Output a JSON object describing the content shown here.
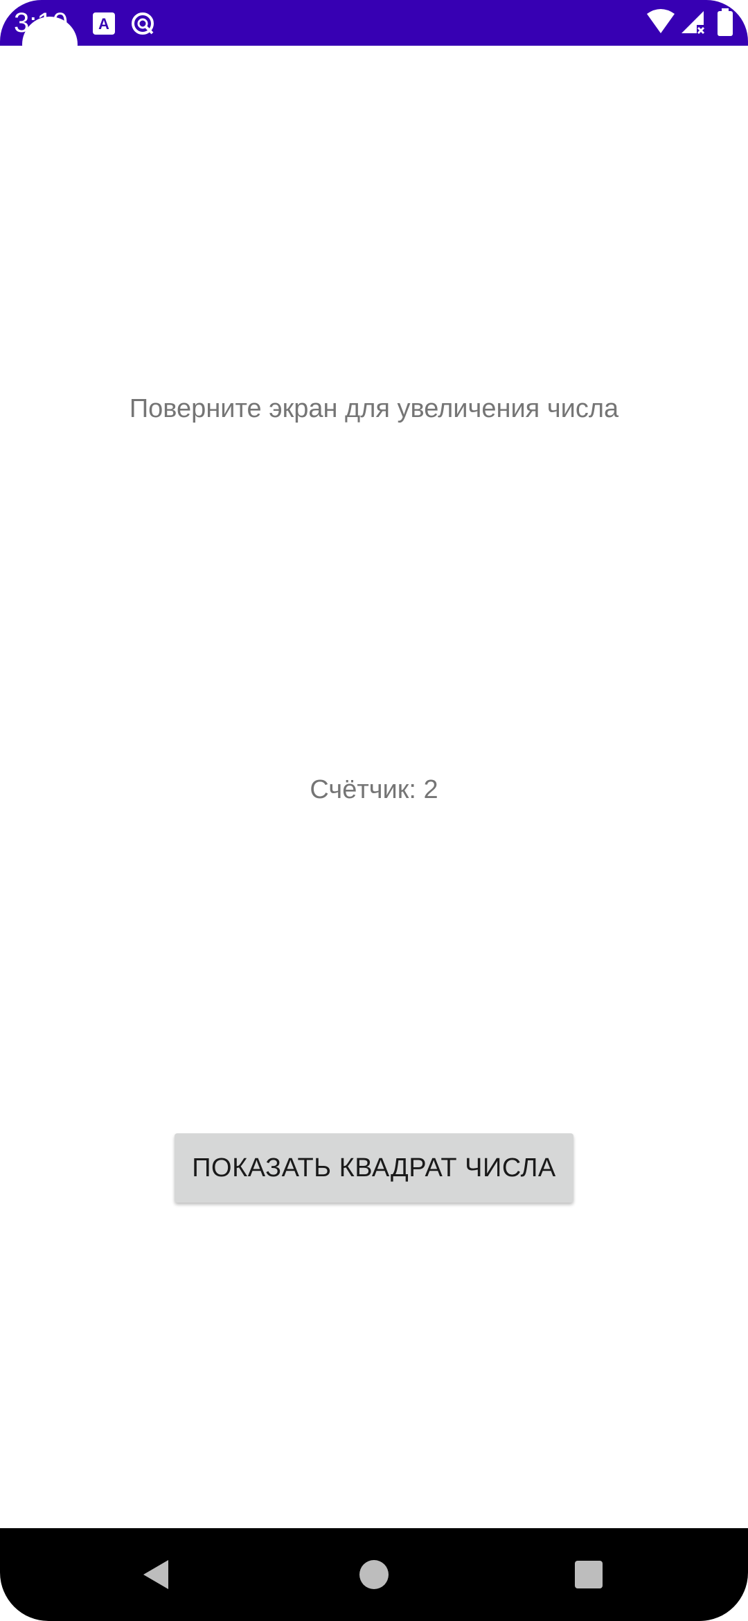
{
  "status_bar": {
    "time": "3:10",
    "background_color": "#3700B3",
    "icons": [
      "accessibility-a-icon",
      "sync-icon",
      "wifi-icon",
      "signal-icon",
      "battery-icon"
    ]
  },
  "main": {
    "instruction": "Поверните экран для увеличения числа",
    "counter": "Счётчик: 2",
    "button_label": "ПОКАЗАТЬ КВАДРАТ ЧИСЛА"
  },
  "nav_bar": {
    "icons": [
      "back-icon",
      "home-icon",
      "recents-icon"
    ]
  }
}
